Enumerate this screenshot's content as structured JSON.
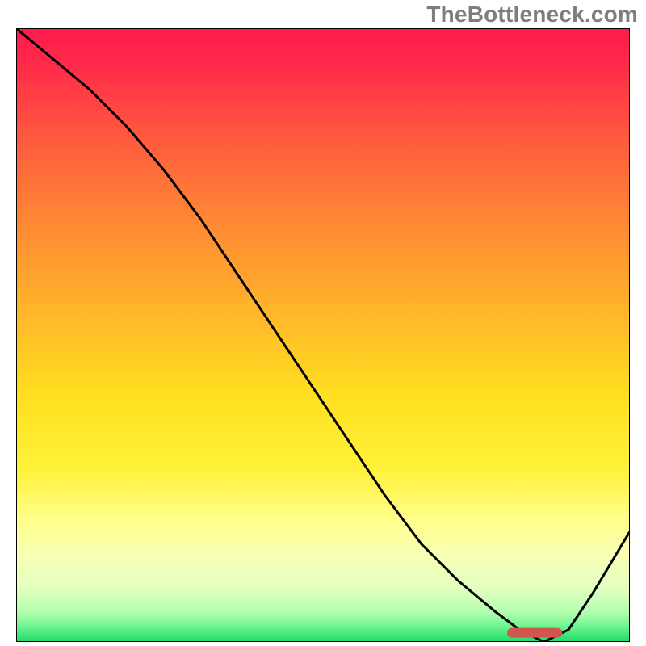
{
  "watermark": "TheBottleneck.com",
  "chart_data": {
    "type": "line",
    "title": "",
    "xlabel": "",
    "ylabel": "",
    "xlim": [
      0,
      100
    ],
    "ylim": [
      0,
      100
    ],
    "grid": false,
    "legend": false,
    "x": [
      0,
      6,
      12,
      18,
      24,
      30,
      36,
      42,
      48,
      54,
      60,
      66,
      72,
      78,
      82,
      86,
      90,
      94,
      100
    ],
    "values": [
      100,
      95,
      90,
      84,
      77,
      69,
      60,
      51,
      42,
      33,
      24,
      16,
      10,
      5,
      2,
      0,
      2,
      8,
      18
    ],
    "optimal_marker": {
      "x_start": 80,
      "x_end": 89,
      "y": 1.5
    },
    "gradient_stops": [
      {
        "offset": 0.0,
        "color": "#ff1a4b"
      },
      {
        "offset": 0.06,
        "color": "#ff2a49"
      },
      {
        "offset": 0.18,
        "color": "#ff5a3e"
      },
      {
        "offset": 0.32,
        "color": "#ff8a34"
      },
      {
        "offset": 0.46,
        "color": "#ffb52a"
      },
      {
        "offset": 0.6,
        "color": "#ffe01f"
      },
      {
        "offset": 0.72,
        "color": "#fff23a"
      },
      {
        "offset": 0.8,
        "color": "#ffff8a"
      },
      {
        "offset": 0.86,
        "color": "#f8ffb5"
      },
      {
        "offset": 0.91,
        "color": "#e4ffc0"
      },
      {
        "offset": 0.95,
        "color": "#b6ffb0"
      },
      {
        "offset": 0.975,
        "color": "#6bf58f"
      },
      {
        "offset": 1.0,
        "color": "#1fd96a"
      }
    ]
  }
}
